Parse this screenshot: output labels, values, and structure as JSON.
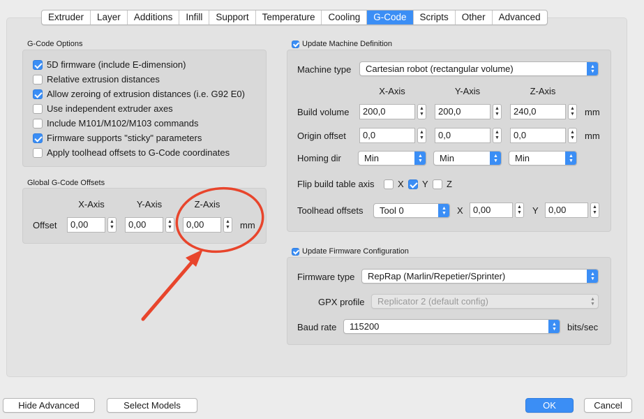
{
  "tabs": [
    "Extruder",
    "Layer",
    "Additions",
    "Infill",
    "Support",
    "Temperature",
    "Cooling",
    "G-Code",
    "Scripts",
    "Other",
    "Advanced"
  ],
  "active_tab": "G-Code",
  "gcode_options": {
    "title": "G-Code Options",
    "options": [
      {
        "label": "5D firmware (include E-dimension)",
        "checked": true
      },
      {
        "label": "Relative extrusion distances",
        "checked": false
      },
      {
        "label": "Allow zeroing of extrusion distances (i.e. G92 E0)",
        "checked": true
      },
      {
        "label": "Use independent extruder axes",
        "checked": false
      },
      {
        "label": "Include M101/M102/M103 commands",
        "checked": false
      },
      {
        "label": "Firmware supports \"sticky\" parameters",
        "checked": true
      },
      {
        "label": "Apply toolhead offsets to G-Code coordinates",
        "checked": false
      }
    ]
  },
  "offsets": {
    "title": "Global G-Code Offsets",
    "x_header": "X-Axis",
    "y_header": "Y-Axis",
    "z_header": "Z-Axis",
    "row_label": "Offset",
    "x": "0,00",
    "y": "0,00",
    "z": "0,00",
    "unit": "mm"
  },
  "machine": {
    "title": "Update Machine Definition",
    "checked": true,
    "type_label": "Machine type",
    "type_value": "Cartesian robot (rectangular volume)",
    "x_header": "X-Axis",
    "y_header": "Y-Axis",
    "z_header": "Z-Axis",
    "build_label": "Build volume",
    "build": [
      "200,0",
      "200,0",
      "240,0"
    ],
    "build_unit": "mm",
    "origin_label": "Origin offset",
    "origin": [
      "0,0",
      "0,0",
      "0,0"
    ],
    "origin_unit": "mm",
    "homing_label": "Homing dir",
    "homing": [
      "Min",
      "Min",
      "Min"
    ],
    "flip_label": "Flip build table axis",
    "flip": [
      {
        "label": "X",
        "checked": false
      },
      {
        "label": "Y",
        "checked": true
      },
      {
        "label": "Z",
        "checked": false
      }
    ],
    "toolhead_label": "Toolhead offsets",
    "tool_value": "Tool 0",
    "tool_x_label": "X",
    "tool_x": "0,00",
    "tool_y_label": "Y",
    "tool_y": "0,00"
  },
  "firmware": {
    "title": "Update Firmware Configuration",
    "checked": true,
    "type_label": "Firmware type",
    "type_value": "RepRap (Marlin/Repetier/Sprinter)",
    "gpx_label": "GPX profile",
    "gpx_value": "Replicator 2 (default config)",
    "baud_label": "Baud rate",
    "baud_value": "115200",
    "baud_unit": "bits/sec"
  },
  "buttons": {
    "hide_advanced": "Hide Advanced",
    "select_models": "Select Models",
    "ok": "OK",
    "cancel": "Cancel"
  },
  "colors": {
    "accent": "#3b8ef5",
    "annotation": "#e8452c"
  }
}
